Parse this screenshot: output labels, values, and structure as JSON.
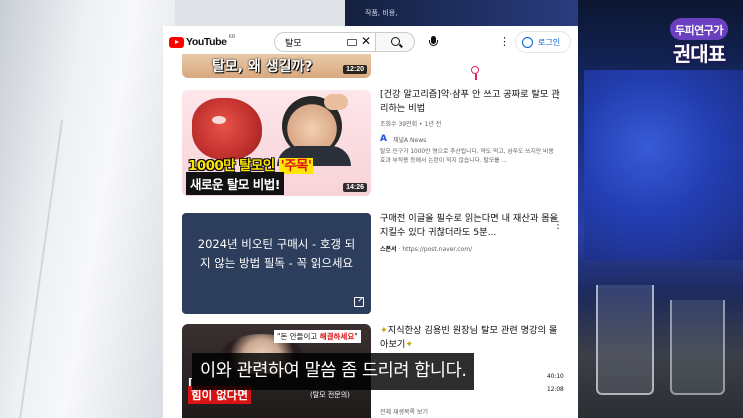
{
  "overlay": {
    "channel_logo_top": "두피연구가",
    "channel_logo_bottom": "권대표",
    "caption": "이와 관련하여 말씀 좀 드리려 합니다."
  },
  "youtube": {
    "logo_text": "YouTube",
    "region": "KR",
    "search_query": "탈모",
    "login_label": "로그인",
    "results": [
      {
        "thumb_caption": "탈모, 왜 생길까?",
        "duration": "12:20"
      },
      {
        "title": "[건강 알고리즘]약·샴푸 안 쓰고 공짜로 탈모 관리하는 비법",
        "meta": "조회수 39만회 • 1년 전",
        "channel": "채널A News",
        "description": "탈모 인구가 1000만 명으로 추산됩니다. 약도 먹고, 샴푸도 쓰지만 비용 효과 부작용 등에서 논란이 적지 않습니다. 탈모를 ...",
        "thumb_line1_a": "1000만 탈모인 ",
        "thumb_line1_b": "'주목'",
        "thumb_line2": "새로운 탈모 비법!",
        "duration": "14:26"
      },
      {
        "title": "구매전 이글을 필수로 읽는다면 내 재산과 몸을 지킬수 있다 귀찮더라도 5분...",
        "sponsor": "스폰서",
        "url": "https://post.naver.com/",
        "thumb_text": "2024년 비오틴 구매시 - 호갱 되지 않는 방법 필독 - 꼭 읽으세요"
      },
      {
        "title": "지식한상 김용빈 원장님 탈모 관련 명강의 몰아보기",
        "thumb_quote_a": "\"돈 안들이고 ",
        "thumb_quote_b": "해결하세요",
        "thumb_quote_c": "\"",
        "thumb_label": "힘이 없다면",
        "thumb_expert": "(탈모 전문의)",
        "playlist_label": "전체 재생목록 보기",
        "ts1": "40:10",
        "ts2": "12:08"
      }
    ]
  },
  "background": {
    "monitor_text": "작품, 비용,"
  }
}
